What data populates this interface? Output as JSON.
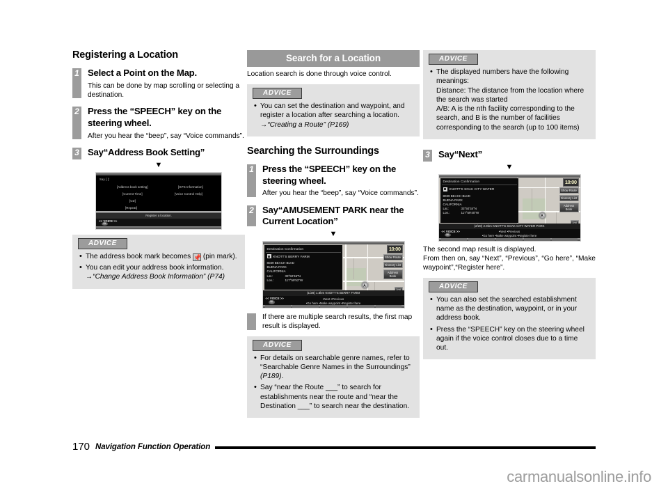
{
  "footer": {
    "page_number": "170",
    "chapter": "Navigation Function Operation",
    "watermark": "carmanualsonline.info"
  },
  "col1": {
    "heading": "Registering a Location",
    "steps": [
      {
        "num": "1",
        "title": "Select a Point on the Map.",
        "body": "This can be done by map scrolling or selecting a destination."
      },
      {
        "num": "2",
        "title": "Press the “SPEECH” key on the steering wheel.",
        "body": "After you hear the “beep”, say “Voice commands”."
      },
      {
        "num": "3",
        "title": "Say“Address Book Setting”",
        "body": ""
      }
    ],
    "arrow": "▼",
    "voice_screen": {
      "say_label": "Say [  ]:",
      "commands_left": [
        "[Address book setting]",
        "[Current Time]",
        "[CD]",
        "[Repeat]"
      ],
      "commands_right": [
        "[GPS Information]",
        "[Voice Control Help]"
      ],
      "status_text": "Register a location.",
      "voice_label": "<< VOICE >>",
      "ok_label": "OK"
    },
    "advice": {
      "tag": "ADVICE",
      "items": [
        {
          "pre": "The address book mark becomes ",
          "icon": "pin-mark-icon",
          "post": " (pin mark)."
        },
        {
          "pre": "You can edit your address book information. →",
          "italic": "“Change Address Book Information” (P74)",
          "post": ""
        }
      ]
    }
  },
  "col2": {
    "band_title": "Search for a Location",
    "intro": "Location search is done through voice control.",
    "advice_top": {
      "tag": "ADVICE",
      "item_pre": "You can set the destination and waypoint, and register a location after searching a location. →",
      "item_italic": "“Creating a Route” (P169)"
    },
    "heading": "Searching the Surroundings",
    "steps": [
      {
        "num": "1",
        "title": "Press the “SPEECH” key on the steering wheel.",
        "body": "After you hear the “beep”, say “Voice commands”."
      },
      {
        "num": "2",
        "title": "Say“AMUSEMENT PARK near the Current Location”",
        "body": "If there are multiple search results, the first map result is displayed."
      }
    ],
    "arrow": "▼",
    "map_screen": {
      "panel_title": "Destination Confirmation",
      "poi_name": "KNOTT'S BERRY FARM",
      "address_lines": [
        "8039 BEACH BLVD",
        "BUENA PARK",
        "CALIFORNIA"
      ],
      "lat_label": "Lat.:",
      "lat_value": "33°50'46\"N",
      "lon_label": "Lon.:",
      "lon_value": "117°59'52\"W",
      "clock": "10:00",
      "side_buttons": [
        "Show Route",
        "Itinerary List",
        "Address Book"
      ],
      "zoom_button": "1mi",
      "result_bar": "(1/28)  1.8km  KNOTT'S BERRY FARM",
      "voice_label": "<< VOICE >>",
      "ok_label": "OK",
      "voice_line1": "•Next •Previous",
      "voice_line2": "•Go here •Make waypoint •Register here"
    },
    "advice_bottom": {
      "tag": "ADVICE",
      "items": [
        {
          "pre": "For details on searchable genre names, refer to “Searchable Genre Names in the Surroundings” ",
          "italic": "(P189)",
          "post": "."
        },
        {
          "pre": "Say “near the Route ___” to search for establishments near the route and “near the Destination ___” to search near the destination.",
          "italic": "",
          "post": ""
        }
      ]
    }
  },
  "col3": {
    "advice_top": {
      "tag": "ADVICE",
      "item": "The displayed numbers have the following meanings:\nDistance: The distance from the location where the search was started\nA/B: A is the nth facility corresponding to the search, and B is the number of facilities corresponding to the search (up to 100 items)"
    },
    "step": {
      "num": "3",
      "title": "Say“Next”"
    },
    "arrow": "▼",
    "map_screen": {
      "panel_title": "Destination Confirmation",
      "poi_name": "KNOTT'S SOAK CITY WATER",
      "address_lines": [
        "8039 BEACH BLVD",
        "BUENA PARK",
        "CALIFORNIA"
      ],
      "lat_label": "Lat.:",
      "lat_value": "33°50'34\"N",
      "lon_label": "Lon.:",
      "lon_value": "117°59'40\"W",
      "clock": "10:00",
      "side_buttons": [
        "Show Route",
        "Itinerary List",
        "Address Book"
      ],
      "zoom_button": "1mi",
      "result_bar": "(2/28)  2.9km  KNOTT'S SOAK CITY WATER PARK",
      "voice_label": "<< VOICE >>",
      "ok_label": "OK",
      "voice_line1": "•Next •Previous",
      "voice_line2": "•Go here •Make waypoint •Register here"
    },
    "para": "The second map result is displayed.\nFrom then on, say “Next”, “Previous”, “Go here”, “Make waypoint”,“Register here”.",
    "advice_bottom": {
      "tag": "ADVICE",
      "items": [
        "You can also set the searched establishment name as the destination, waypoint, or in your address book.",
        "Press the “SPEECH” key on the steering wheel again if the voice control closes due to a time out."
      ]
    }
  }
}
